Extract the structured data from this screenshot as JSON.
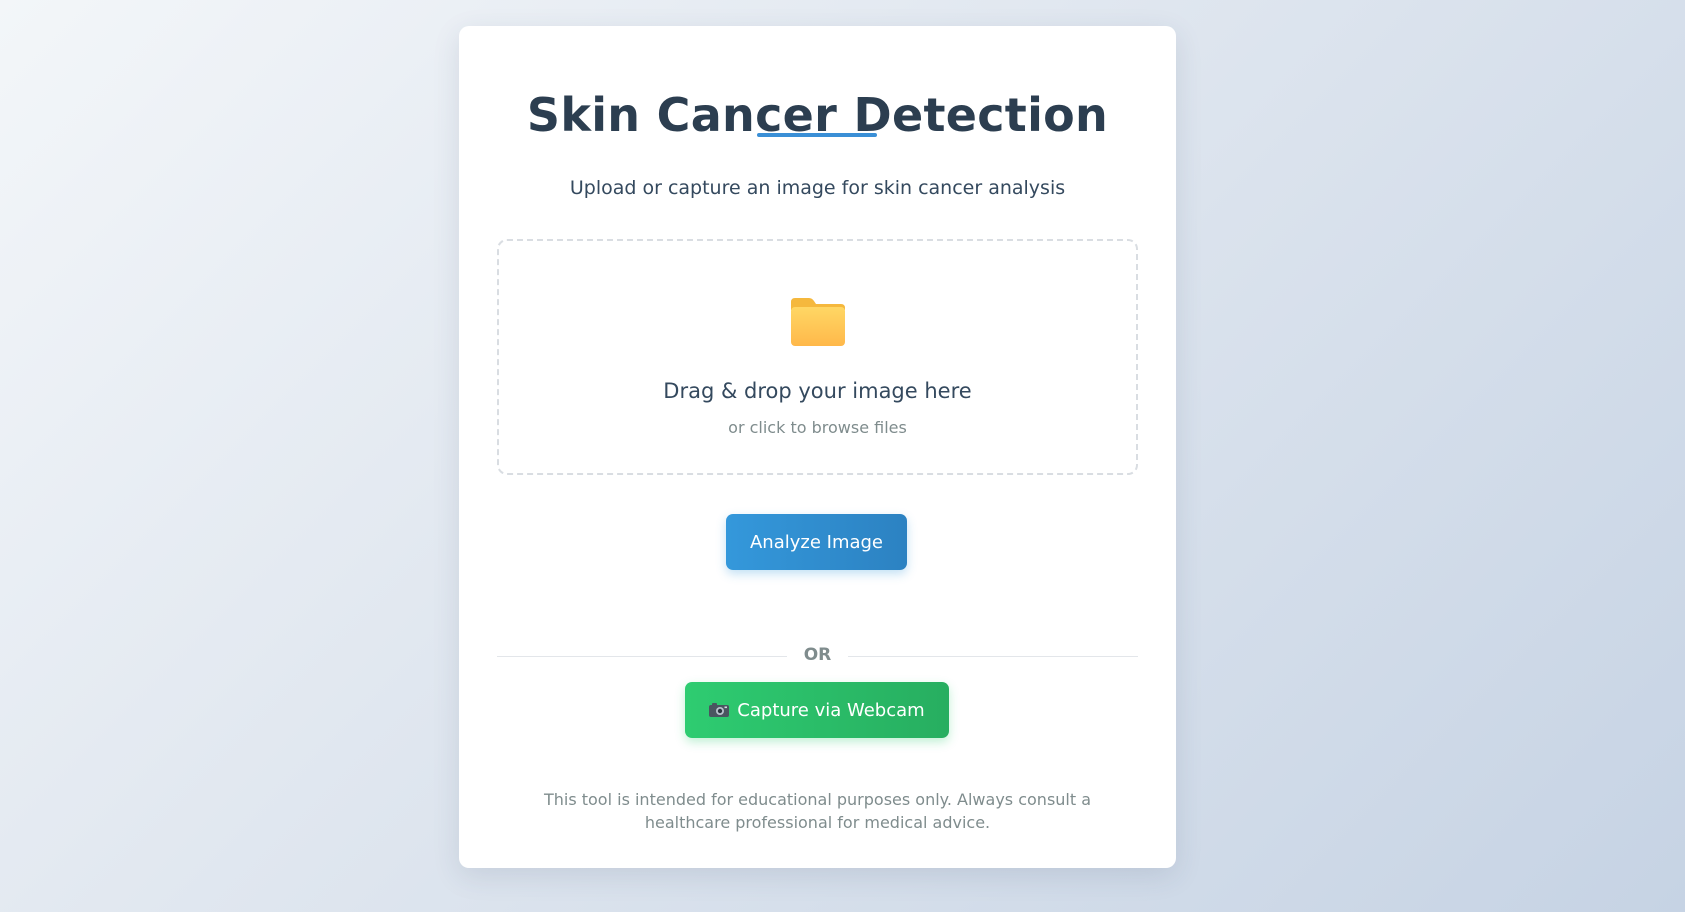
{
  "app": {
    "title": "Skin Cancer Detection",
    "subtitle": "Upload or capture an image for skin cancer analysis"
  },
  "upload": {
    "icon": "folder-icon",
    "drop_title": "Drag & drop your image here",
    "drop_subtitle": "or click to browse files"
  },
  "actions": {
    "analyze_label": "Analyze Image",
    "divider_label": "OR",
    "webcam_icon": "camera-icon",
    "webcam_label": "Capture via Webcam"
  },
  "footer": {
    "disclaimer": "This tool is intended for educational purposes only. Always consult a healthcare professional for medical advice."
  },
  "colors": {
    "accent_blue": "#3498db",
    "accent_green": "#2ecc71",
    "title_text": "#2c3e50",
    "folder_yellow": "#ffc94d"
  }
}
